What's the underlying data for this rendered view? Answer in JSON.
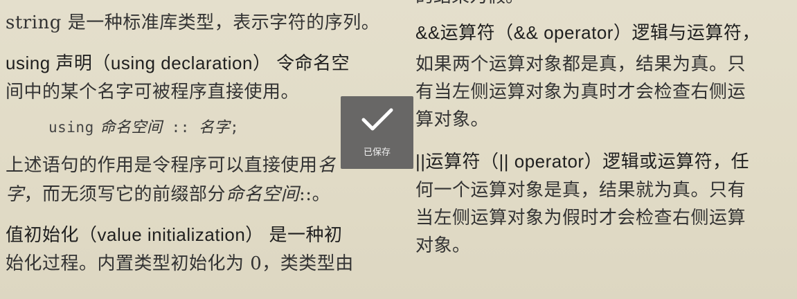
{
  "left": {
    "p1": "string 是一种标准库类型，表示字符的序列。",
    "p2_l1": "using 声明（using declaration） 令命名空",
    "p2_l2": "间中的某个名字可被程序直接使用。",
    "code_kw": "using",
    "code_ns": "命名空间",
    "code_sep": " :: ",
    "code_name": "名字",
    "code_end": ";",
    "p3_l1_a": "上述语句的作用是令程序可以直接使用",
    "p3_l1_b": "名",
    "p3_l2_a": "字",
    "p3_l2_b": "，而无须写它的前缀部分",
    "p3_l2_c": "命名空间",
    "p3_l2_d": "::。",
    "p4_l1": "值初始化（value initialization） 是一种初",
    "p4_l2": "始化过程。内置类型初始化为 0，类类型由"
  },
  "right": {
    "top_cut": "的结果为假。",
    "p1_l1": "&&运算符（&& operator）逻辑与运算符，",
    "p1_l2": "如果两个运算对象都是真，结果为真。只",
    "p1_l3": "有当左侧运算对象为真时才会检查右侧运",
    "p1_l4": "算对象。",
    "p2_l1": "||运算符（|| operator）逻辑或运算符，任",
    "p2_l2": "何一个运算对象是真，结果就为真。只有",
    "p2_l3": "当左侧运算对象为假时才会检查右侧运算",
    "p2_l4": "对象。"
  },
  "toast": {
    "icon": "checkmark-icon",
    "label": "已保存"
  }
}
